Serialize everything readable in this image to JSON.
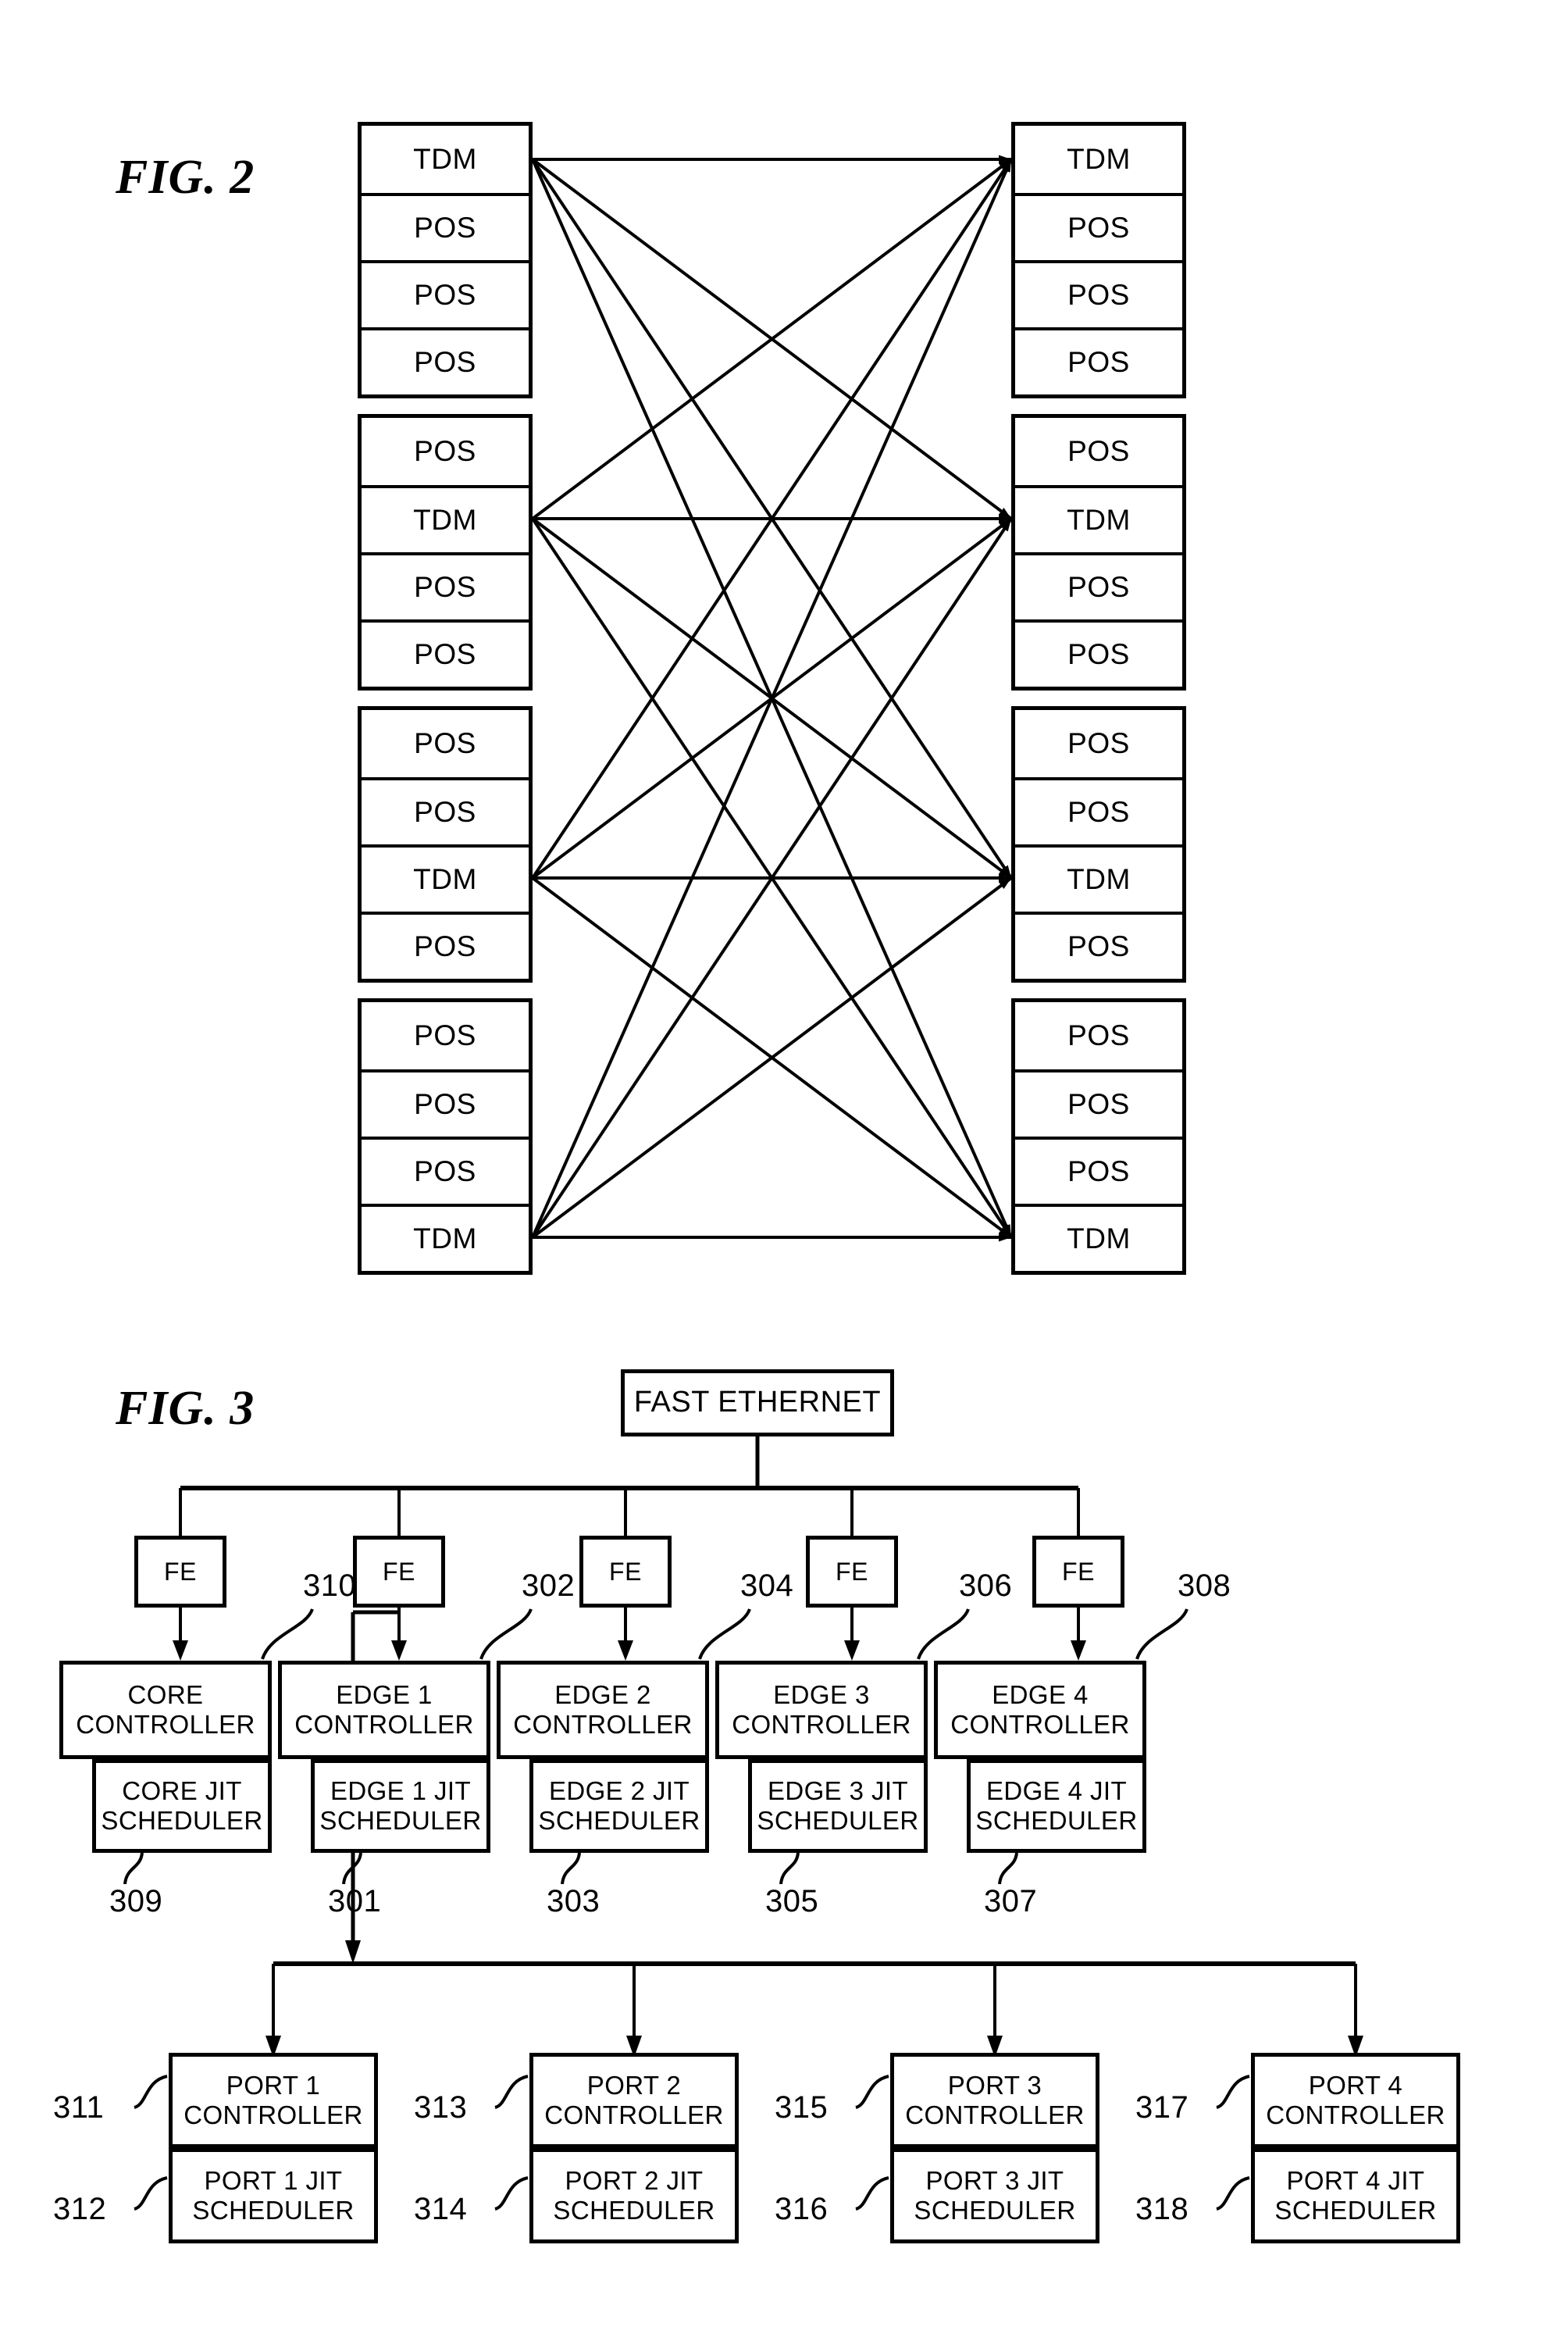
{
  "figures": {
    "fig2": {
      "label": "FIG. 2",
      "left_groups": [
        {
          "cells": [
            "TDM",
            "POS",
            "POS",
            "POS"
          ]
        },
        {
          "cells": [
            "POS",
            "TDM",
            "POS",
            "POS"
          ]
        },
        {
          "cells": [
            "POS",
            "POS",
            "TDM",
            "POS"
          ]
        },
        {
          "cells": [
            "POS",
            "POS",
            "POS",
            "TDM"
          ]
        }
      ],
      "right_groups": [
        {
          "cells": [
            "TDM",
            "POS",
            "POS",
            "POS"
          ]
        },
        {
          "cells": [
            "POS",
            "TDM",
            "POS",
            "POS"
          ]
        },
        {
          "cells": [
            "POS",
            "POS",
            "TDM",
            "POS"
          ]
        },
        {
          "cells": [
            "POS",
            "POS",
            "POS",
            "TDM"
          ]
        }
      ]
    },
    "fig3": {
      "label": "FIG. 3",
      "root": {
        "label": "FAST ETHERNET"
      },
      "fe_nodes": [
        {
          "label": "FE"
        },
        {
          "label": "FE"
        },
        {
          "label": "FE"
        },
        {
          "label": "FE"
        },
        {
          "label": "FE"
        }
      ],
      "controllers": [
        {
          "ref": "310",
          "ref_below": "309",
          "title": "CORE\nCONTROLLER",
          "scheduler": "CORE JIT\nSCHEDULER"
        },
        {
          "ref": "302",
          "ref_below": "301",
          "title": "EDGE 1\nCONTROLLER",
          "scheduler": "EDGE 1 JIT\nSCHEDULER"
        },
        {
          "ref": "304",
          "ref_below": "303",
          "title": "EDGE 2\nCONTROLLER",
          "scheduler": "EDGE 2 JIT\nSCHEDULER"
        },
        {
          "ref": "306",
          "ref_below": "305",
          "title": "EDGE 3\nCONTROLLER",
          "scheduler": "EDGE 3 JIT\nSCHEDULER"
        },
        {
          "ref": "308",
          "ref_below": "307",
          "title": "EDGE 4\nCONTROLLER",
          "scheduler": "EDGE 4 JIT\nSCHEDULER"
        }
      ],
      "ports": [
        {
          "ref_ctrl": "311",
          "ref_sched": "312",
          "title": "PORT 1\nCONTROLLER",
          "scheduler": "PORT 1 JIT\nSCHEDULER"
        },
        {
          "ref_ctrl": "313",
          "ref_sched": "314",
          "title": "PORT 2\nCONTROLLER",
          "scheduler": "PORT 2 JIT\nSCHEDULER"
        },
        {
          "ref_ctrl": "315",
          "ref_sched": "316",
          "title": "PORT 3\nCONTROLLER",
          "scheduler": "PORT 3 JIT\nSCHEDULER"
        },
        {
          "ref_ctrl": "317",
          "ref_sched": "318",
          "title": "PORT 4\nCONTROLLER",
          "scheduler": "PORT 4 JIT\nSCHEDULER"
        }
      ]
    }
  },
  "colors": {
    "ink": "#000000",
    "paper": "#ffffff"
  }
}
